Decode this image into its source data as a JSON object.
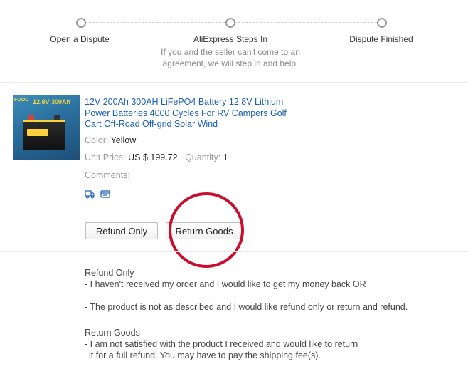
{
  "steps": [
    {
      "label": "Open a Dispute"
    },
    {
      "label": "AliExpress Steps In",
      "desc_line1": "If you and the seller can't come to an",
      "desc_line2": "agreement, we will step in and help."
    },
    {
      "label": "Dispute Finished"
    }
  ],
  "product": {
    "title": "12V 200Ah 300AH LiFePO4 Battery 12.8V Lithium Power Batteries 4000 Cycles For RV Campers Golf Cart Off-Road Off-grid Solar Wind",
    "thumb_text": "12.8V 300Ah",
    "thumb_brand": "FOOD",
    "color_label": "Color:",
    "color_value": "Yellow",
    "unit_price_label": "Unit Price:",
    "unit_price_value": "US $ 199.72",
    "quantity_label": "Quantity:",
    "quantity_value": "1",
    "comments_label": "Comments:"
  },
  "buttons": {
    "refund_only": "Refund Only",
    "return_goods": "Return Goods"
  },
  "annotation_color": "#c8102e",
  "link_color": "#1a5fb4",
  "info": {
    "refund_heading": "Refund Only",
    "refund_line1": "- I haven't received my order and I would like to get my money back OR",
    "refund_line2": "- The product is not as described and I would like refund only or return and refund.",
    "return_heading": "Return Goods",
    "return_line1": "- I am not satisfied with the product I received and would like to return",
    "return_line2": "it for a full refund. You may have to pay the shipping fee(s)."
  }
}
